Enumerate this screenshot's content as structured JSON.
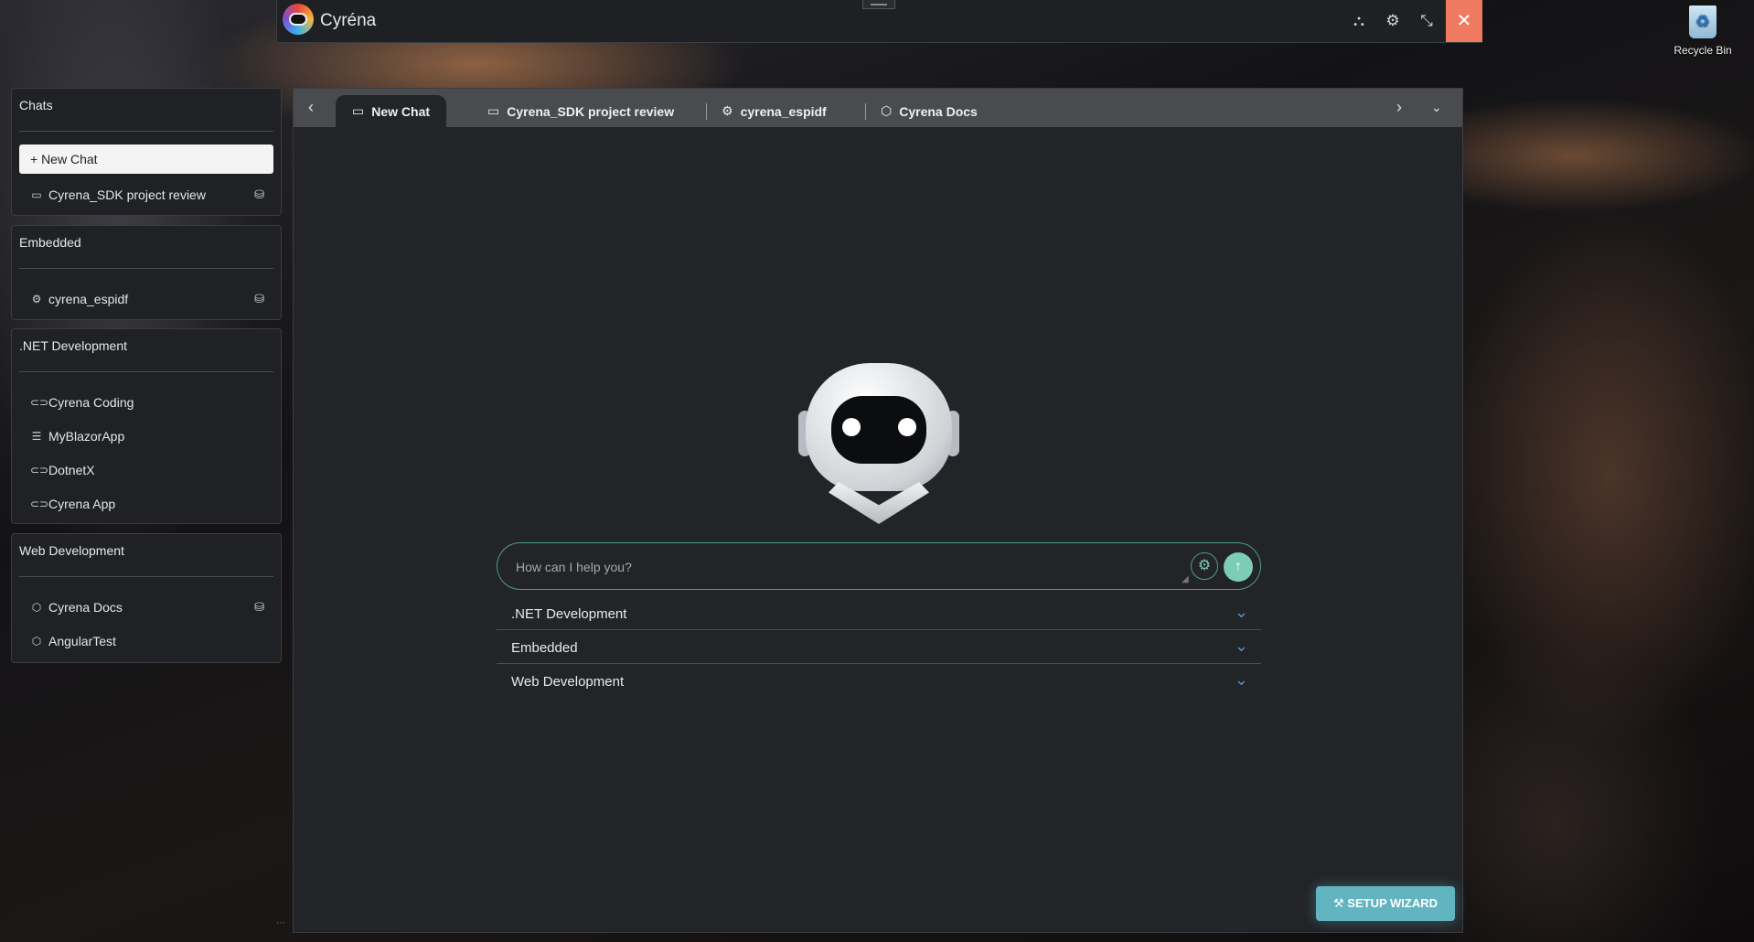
{
  "window": {
    "title": "Cyréna",
    "toolbar_icons": [
      "network-icon",
      "gear-icon",
      "collapse-icon"
    ],
    "close_glyph": "✕"
  },
  "desktop": {
    "recycle_bin_label": "Recycle Bin"
  },
  "sidebar": {
    "groups": [
      {
        "title": "Chats",
        "new_chat_label": "+  New Chat",
        "items": [
          {
            "label": "Cyrena_SDK project review",
            "icon": "chat-icon",
            "has_db": true
          }
        ]
      },
      {
        "title": "Embedded",
        "items": [
          {
            "label": "cyrena_espidf",
            "icon": "chip-icon",
            "has_db": true
          }
        ]
      },
      {
        "title": ".NET Development",
        "items": [
          {
            "label": "Cyrena Coding",
            "icon": "pill-icon"
          },
          {
            "label": "MyBlazorApp",
            "icon": "server-icon"
          },
          {
            "label": "DotnetX",
            "icon": "pill-icon"
          },
          {
            "label": "Cyrena App",
            "icon": "pill-icon"
          }
        ]
      },
      {
        "title": "Web Development",
        "items": [
          {
            "label": "Cyrena Docs",
            "icon": "box-icon",
            "has_db": true
          },
          {
            "label": "AngularTest",
            "icon": "box-icon"
          }
        ]
      }
    ]
  },
  "tabs": [
    {
      "label": "New Chat",
      "icon": "chat-icon",
      "active": true
    },
    {
      "label": "Cyrena_SDK project review",
      "icon": "chat-icon"
    },
    {
      "label": "cyrena_espidf",
      "icon": "chip-icon"
    },
    {
      "label": "Cyrena Docs",
      "icon": "box-icon"
    }
  ],
  "composer": {
    "placeholder": "How can I help you?"
  },
  "sections": [
    {
      "label": ".NET Development"
    },
    {
      "label": "Embedded"
    },
    {
      "label": "Web Development"
    }
  ],
  "wizard_label": "SETUP WIZARD",
  "colors": {
    "accent": "#62b4c0",
    "send": "#7ccdb6",
    "close": "#f07a5f",
    "panel": "#222427"
  }
}
